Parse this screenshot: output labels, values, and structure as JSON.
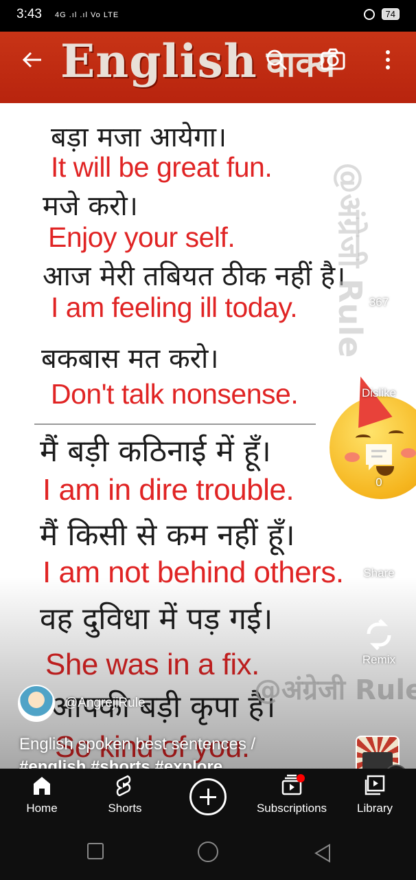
{
  "status_bar": {
    "time": "3:43",
    "network": "4G .ıl .ıl Vo LTE",
    "battery": "74"
  },
  "video": {
    "header_word": "English",
    "header_hindi": "वाक्य",
    "watermark_side": "@अंग्रेजी Rule",
    "watermark_bottom": "@अंग्रेजी Rule",
    "sentences": [
      {
        "hi": "बड़ा मजा आयेगा।",
        "en": "It will be great fun."
      },
      {
        "hi": "मजे करो।",
        "en": "Enjoy your self."
      },
      {
        "hi": "आज मेरी तबियत ठीक नहीं है।",
        "en": "I am feeling ill today."
      },
      {
        "hi": "बकबास मत करो।",
        "en": "Don't talk nonsense."
      },
      {
        "hi": "मैं बड़ी कठिनाई में हूँ।",
        "en": "I am in dire trouble."
      },
      {
        "hi": "मैं किसी से कम नहीं हूँ।",
        "en": "I am not behind others."
      },
      {
        "hi": "वह दुविधा में पड़ गई।",
        "en": "She was in a fix."
      },
      {
        "hi": "आपकी बड़ी कृपा है।",
        "en": "So kind of you."
      }
    ]
  },
  "actions": {
    "like_count": "367",
    "dislike_label": "Dislike",
    "comment_count": "0",
    "share_label": "Share",
    "remix_label": "Remix"
  },
  "channel": {
    "handle": "@AngrejiRule"
  },
  "title": {
    "text": "English spoken best sentences /",
    "tags": "#english #shorts #explore"
  },
  "bottom_nav": {
    "home": "Home",
    "shorts": "Shorts",
    "subscriptions": "Subscriptions",
    "library": "Library"
  }
}
